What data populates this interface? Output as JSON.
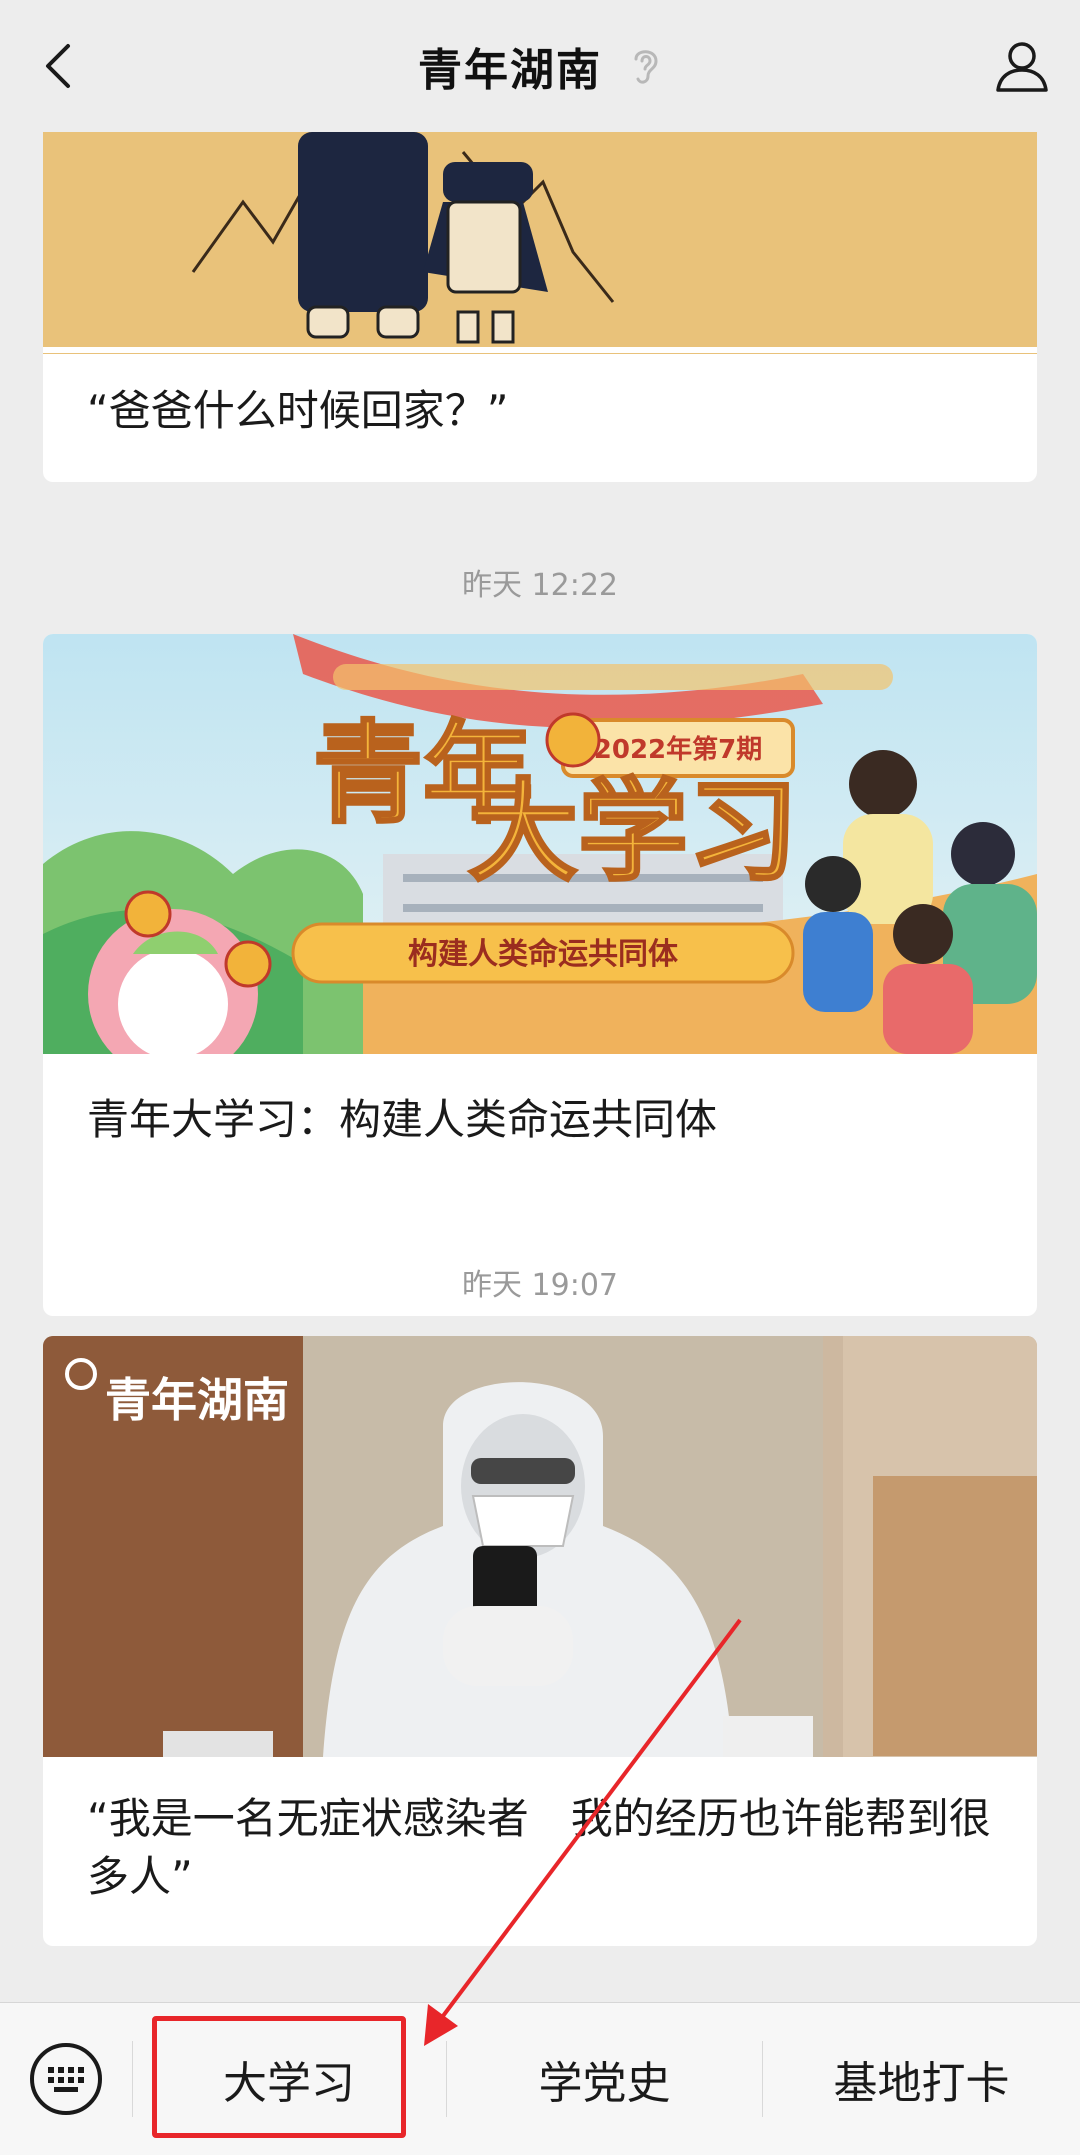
{
  "header": {
    "title": "青年湖南"
  },
  "feed": {
    "cards": [
      {
        "title": "“爸爸什么时候回家？”"
      },
      {
        "time": "昨天 12:22",
        "title": "青年大学习：构建人类命运共同体",
        "banner": {
          "badge": "2022年第7期",
          "headline_1": "青年",
          "headline_2": "大学习",
          "subtitle": "构建人类命运共同体"
        }
      },
      {
        "time": "昨天 19:07",
        "title": "“我是一名无症状感染者　我的经历也许能帮到很多人”",
        "watermark": "青年湖南"
      }
    ]
  },
  "bottom_menu": {
    "items": [
      {
        "label": "大学习"
      },
      {
        "label": "学党史"
      },
      {
        "label": "基地打卡"
      }
    ]
  },
  "colors": {
    "background": "#ededed",
    "card": "#ffffff",
    "annotation_red": "#e8262a",
    "time_text": "#9a9a9a"
  },
  "icons": [
    "back-arrow-icon",
    "ear-icon",
    "profile-icon",
    "keyboard-icon"
  ]
}
